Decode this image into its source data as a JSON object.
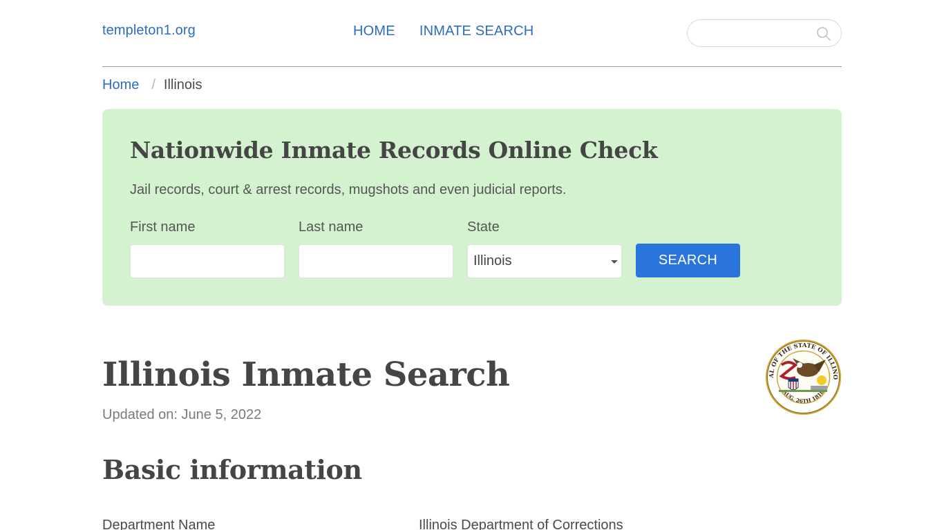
{
  "header": {
    "logo": "templeton1.org",
    "nav": [
      {
        "label": "HOME"
      },
      {
        "label": "INMATE SEARCH"
      }
    ],
    "search": {
      "placeholder": "",
      "value": "",
      "icon": "search-icon"
    }
  },
  "breadcrumb": {
    "items": [
      {
        "label": "Home"
      },
      {
        "label": "Illinois"
      }
    ],
    "separator": "/"
  },
  "hero": {
    "title": "Nationwide Inmate Records Online Check",
    "subtitle": "Jail records, court & arrest records, mugshots and even judicial reports.",
    "fields": {
      "first_name": {
        "label": "First name",
        "value": "",
        "placeholder": ""
      },
      "last_name": {
        "label": "Last name",
        "value": "",
        "placeholder": ""
      },
      "state": {
        "label": "State",
        "selected": "Illinois"
      }
    },
    "search_label": "SEARCH",
    "colors": {
      "panel_bg": "#d5f2d0",
      "button": "#2a74de"
    }
  },
  "main": {
    "title": "Illinois Inmate Search",
    "updated": "Updated on: June 5, 2022",
    "seal_alt": "Seal of the State of Illinois",
    "seal_text_top": "SEAL OF THE STATE OF ILLINOIS",
    "seal_text_bottom": "AUG. 26TH 1818",
    "section_title": "Basic information",
    "info": [
      {
        "key": "Department Name",
        "value": "Illinois Department of Corrections"
      }
    ]
  },
  "colors": {
    "link": "#2b6cc4",
    "text": "#4a4a4a"
  }
}
